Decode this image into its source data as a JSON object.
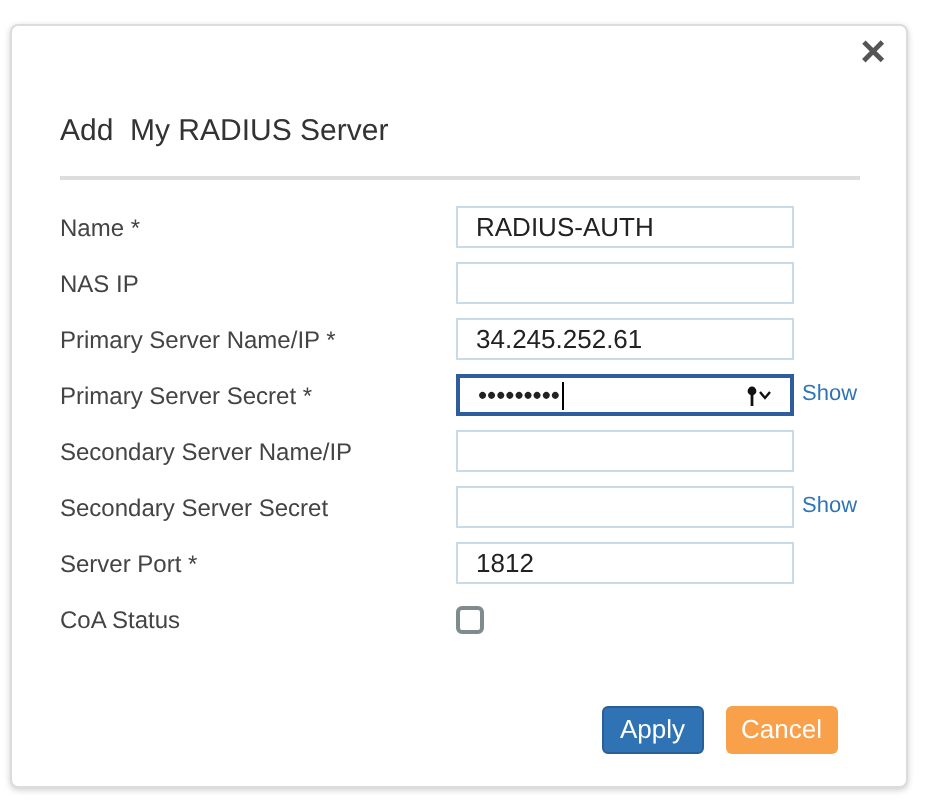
{
  "dialog": {
    "title": "Add  My RADIUS Server",
    "close": "×"
  },
  "fields": [
    {
      "kind": "text",
      "label": "Name *",
      "value": "RADIUS-AUTH",
      "focused": false
    },
    {
      "kind": "text",
      "label": "NAS IP",
      "focused": false
    },
    {
      "kind": "text",
      "label": "Primary Server Name/IP *",
      "value": "34.245.252.61",
      "focused": false
    },
    {
      "kind": "password",
      "label": "Primary Server Secret *",
      "value": "•••••••••",
      "focused": true,
      "link": "Show"
    },
    {
      "kind": "text",
      "label": "Secondary Server Name/IP",
      "focused": false
    },
    {
      "kind": "password",
      "label": "Secondary Server Secret",
      "focused": false,
      "link": "Show"
    },
    {
      "kind": "text",
      "label": "Server Port *",
      "value": "1812",
      "focused": false
    },
    {
      "kind": "checkbox",
      "label": "CoA Status",
      "checked": false
    }
  ],
  "buttons": [
    {
      "kind": "primary",
      "label": "Apply"
    },
    {
      "kind": "secondary",
      "label": "Cancel"
    }
  ]
}
